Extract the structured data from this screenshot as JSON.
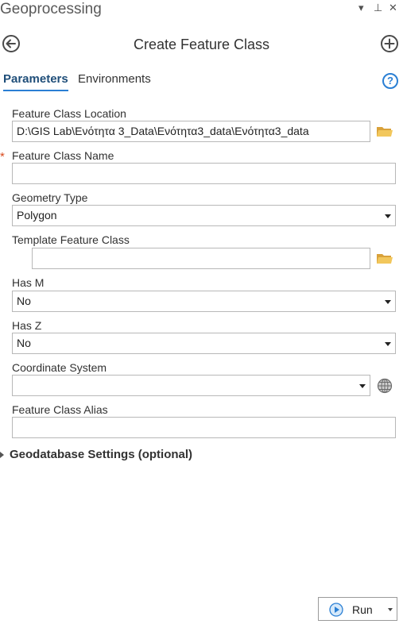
{
  "window": {
    "title": "Geoprocessing",
    "controls": [
      "▾",
      "⊥",
      "✕"
    ]
  },
  "tool": {
    "title": "Create Feature Class"
  },
  "tabs": [
    {
      "label": "Parameters",
      "active": true
    },
    {
      "label": "Environments",
      "active": false
    }
  ],
  "help": {
    "symbol": "?"
  },
  "required_marker": "*",
  "fields": {
    "location": {
      "label": "Feature Class Location",
      "value": "D:\\GIS Lab\\Ενότητα 3_Data\\Ενότητα3_data\\Ενότητα3_data"
    },
    "name": {
      "label": "Feature Class Name",
      "value": ""
    },
    "geometry": {
      "label": "Geometry Type",
      "value": "Polygon"
    },
    "template": {
      "label": "Template Feature Class",
      "value": ""
    },
    "has_m": {
      "label": "Has M",
      "value": "No"
    },
    "has_z": {
      "label": "Has Z",
      "value": "No"
    },
    "coord": {
      "label": "Coordinate System",
      "value": ""
    },
    "alias": {
      "label": "Feature Class Alias",
      "value": ""
    }
  },
  "geodatabase_settings": {
    "label": "Geodatabase Settings (optional)"
  },
  "run": {
    "label": "Run"
  },
  "colors": {
    "accent": "#2a7fd4",
    "required": "#d94b1f",
    "folder": "#e8b74a"
  }
}
